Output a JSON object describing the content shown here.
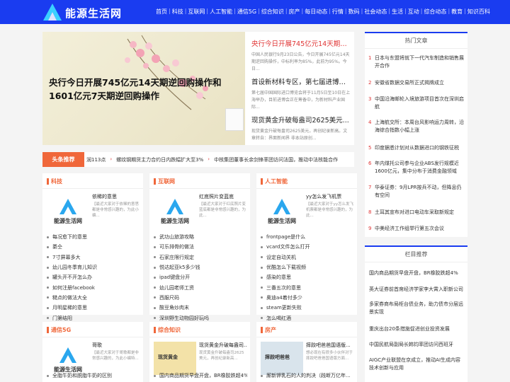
{
  "site": {
    "name": "能源生活网"
  },
  "nav": [
    "首页",
    "科技",
    "互联网",
    "人工智能",
    "通信5G",
    "综合知识",
    "房产",
    "每日动态",
    "行情",
    "数码",
    "社会动态",
    "生活",
    "互动",
    "综合动态",
    "教育",
    "知识百科"
  ],
  "banner": {
    "title": "央行今日开展745亿元14天期逆回购操作和1601亿元7天期逆回购操作"
  },
  "headlines": [
    {
      "title": "央行今日开展745亿元14天期逆...",
      "desc": "中国人民银行9月23日公告，今日开展745亿元14天期逆回购操作，中标利率为85%，此前为95%。今日..."
    },
    {
      "title": "首设新材料专区，第七届进博会...",
      "desc": "第七届中国国际进口博览会将于11月5日至10日在上海举办，目前进博会正在筹备中，为新材料产业国际..."
    },
    {
      "title": "现货黄金升破每盎司2625美元...",
      "desc": "现货黄金升破每盎司2625美元，再创纪录新高。文章转自：界面新闻界 非本站原创..."
    }
  ],
  "ticker": {
    "label": "头条推荐",
    "items": [
      "润113点",
      "螺纹钢期货主力合约日内跌幅扩大至3%",
      "中核集团董事长余剑锋率团访问法国，推动中法核能合作"
    ]
  },
  "hot": {
    "title": "热门文章",
    "items": [
      {
        "n": "1",
        "text": "日本与东盟将就下一代汽车制造和销售展开合作"
      },
      {
        "n": "2",
        "text": "安徽省数据交易所正式揭牌成立"
      },
      {
        "n": "3",
        "text": "中国沿海邮轮入境旅游项目首次在深圳启航"
      },
      {
        "n": "4",
        "text": "上海航交所：本周台风影响运力周转，沿海综合指数小幅上涨"
      },
      {
        "n": "5",
        "text": "印度据悉计划对从数据进口的钢铁征税"
      },
      {
        "n": "6",
        "text": "年内煤托公司参与企业ABS发行规模近1600亿元，集中分布于消费金融领域"
      },
      {
        "n": "7",
        "text": "华泰证券：9月LPR按兵不动，但降息仍有空间"
      },
      {
        "n": "8",
        "text": "土耳其宣布对进口电动车采取新规定"
      },
      {
        "n": "9",
        "text": "中美经济工作组举行第五次会议"
      }
    ]
  },
  "rec": {
    "title": "栏目推荐",
    "items": [
      "国内商品期货早盘开盘，BR橡胶跌超4%",
      "英大证券前首席经济学家李大霄入职新公司",
      "多家券商布局柜台债业务，助力债市分层远景实现",
      "重庆出台20条措施促进创业投资发展",
      "中国民航局副局长韩钧率团访问西班牙",
      "AIGC产业联盟在京成立，推动AI生成内容技术创新与应用"
    ]
  },
  "cards": [
    {
      "title": "科技",
      "feat": "依稀的意思",
      "desc": "【最近大家对于依稀的意思都是非常感兴趣的，为此小编..."
    },
    {
      "title": "互联网",
      "feat": "红底照片变蓝底",
      "desc": "【最近大家对于红底照片变蓝底都是非常感兴趣的，为此..."
    },
    {
      "title": "人工智能",
      "feat": "yy怎么发飞机票",
      "desc": "【最近大家对于yy怎么发飞机票都是非常感兴趣的，为此..."
    },
    {
      "title": "通信5G",
      "feat": "哥歌",
      "desc": "【最近大家对于哥歌都是非常感兴趣的，为此小编特..."
    },
    {
      "title": "综合知识",
      "feat": "现货黄金升破每盎司...",
      "desc": "现货黄金升破每盎司2625美元，再创纪录新高..."
    },
    {
      "title": "房产",
      "feat": "摔跤吧爸爸国语版...",
      "desc": "想必现在有很多小伙伴对于摔跤吧爸爸国语版方面..."
    }
  ],
  "thumbs": {
    "gold": "现货黄金",
    "movie": "摔跤吧爸爸"
  },
  "lists": [
    [
      "每况愈下的意思",
      "綦仝",
      "7寸屏幕多大",
      "幼儿园冬季育儿知识",
      "罐头开不开怎么办",
      "如何注册facebook",
      "糙点的做法大全",
      "月明星稀的意思",
      "门第结阳"
    ],
    [
      "武功山旅游攻略",
      "可乐排骨的做法",
      "石家庄限行规定",
      "悦达起亚k5多少钱",
      "ipad键盘分开",
      "幼儿园老师工资",
      "西服尺码",
      "酸豆角炒肉末",
      "深圳野生动物园好玩吗"
    ],
    [
      "frontpage是什么",
      "vcard文件怎么打开",
      "设定自动关机",
      "优酷怎么下载视频",
      "感染的意思",
      "三番五次的意思",
      "奥迪a4着付多少",
      "steam更新失败",
      "怎么喝红酒"
    ],
    [
      "全脂牛奶和脱脂牛奶的区别"
    ],
    [
      "国内商品期货早盘开盘，BR橡胶跌超4%"
    ],
    [
      "厮新钾乳石的人的判决（践断万亿年..."
    ]
  ]
}
